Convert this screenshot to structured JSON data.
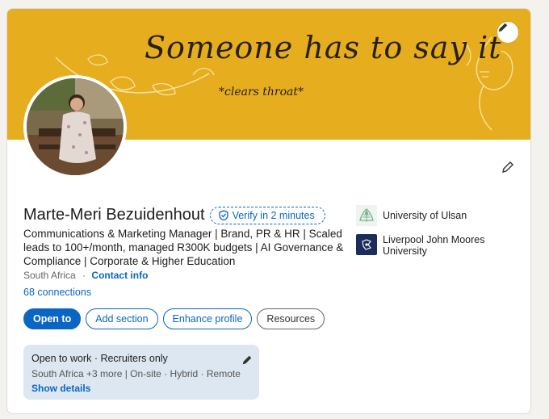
{
  "banner": {
    "title": "Someone has to say it",
    "subtitle": "*clears throat*",
    "color": "#e6ad1e"
  },
  "profile": {
    "name": "Marte-Meri Bezuidenhout",
    "verify_label": "Verify in 2 minutes",
    "headline": "Communications & Marketing Manager | Brand, PR & HR | Scaled leads to 100+/month, managed R300K budgets | AI Governance & Compliance | Corporate & Higher Education",
    "location": "South Africa",
    "separator": "·",
    "contact_info": "Contact info",
    "connections": "68 connections"
  },
  "actions": {
    "open_to": "Open to",
    "add_section": "Add section",
    "enhance_profile": "Enhance profile",
    "resources": "Resources"
  },
  "open_to_work": {
    "title": "Open to work · Recruiters only",
    "details": "South Africa +3 more | On-site · Hybrid · Remote",
    "link": "Show details"
  },
  "education": [
    {
      "name": "University of Ulsan",
      "icon": "university-of-ulsan-logo"
    },
    {
      "name": "Liverpool John Moores University",
      "icon": "liverpool-john-moores-logo"
    }
  ],
  "colors": {
    "accent": "#0a66c2",
    "banner": "#e6ad1e",
    "open_to_work_bg": "#dde7f1"
  }
}
